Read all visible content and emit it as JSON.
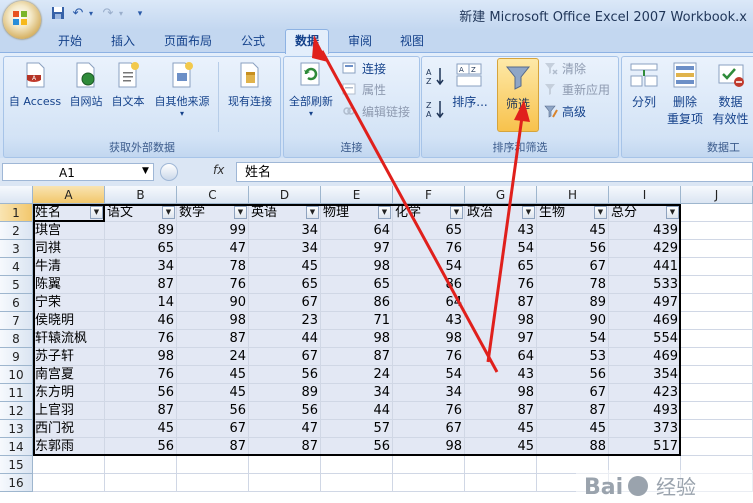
{
  "window": {
    "title": "新建 Microsoft Office Excel 2007 Workbook.x"
  },
  "quick_access": [
    "save-icon",
    "undo-icon",
    "redo-icon",
    "customize-icon"
  ],
  "tabs": [
    {
      "label": "开始"
    },
    {
      "label": "插入"
    },
    {
      "label": "页面布局"
    },
    {
      "label": "公式"
    },
    {
      "label": "数据",
      "active": true
    },
    {
      "label": "审阅"
    },
    {
      "label": "视图"
    }
  ],
  "ribbon": {
    "get_external": {
      "label": "获取外部数据",
      "buttons": [
        "自 Access",
        "自网站",
        "自文本",
        "自其他来源",
        "现有连接"
      ]
    },
    "connections": {
      "label": "连接",
      "refresh_all": "全部刷新",
      "connections": "连接",
      "properties": "属性",
      "edit_links": "编辑链接"
    },
    "sort_filter": {
      "label": "排序和筛选",
      "sort": "排序...",
      "filter": "筛选",
      "clear": "清除",
      "reapply": "重新应用",
      "advanced": "高级"
    },
    "data_tools": {
      "label": "数据工",
      "text_to_columns": "分列",
      "remove_duplicates_1": "删除",
      "remove_duplicates_2": "重复项",
      "validation_1": "数据",
      "validation_2": "有效性"
    }
  },
  "formula_bar": {
    "name_box": "A1",
    "fx": "fx",
    "value": "姓名"
  },
  "columns": [
    "A",
    "B",
    "C",
    "D",
    "E",
    "F",
    "G",
    "H",
    "I",
    "J"
  ],
  "rows": [
    "1",
    "2",
    "3",
    "4",
    "5",
    "6",
    "7",
    "8",
    "9",
    "10",
    "11",
    "12",
    "13",
    "14",
    "15",
    "16"
  ],
  "headers": [
    "姓名",
    "语文",
    "数学",
    "英语",
    "物理",
    "化学",
    "政治",
    "生物",
    "总分"
  ],
  "data": [
    [
      "琪宫",
      "89",
      "99",
      "34",
      "64",
      "65",
      "43",
      "45",
      "439"
    ],
    [
      "司祺",
      "65",
      "47",
      "34",
      "97",
      "76",
      "54",
      "56",
      "429"
    ],
    [
      "牛清",
      "34",
      "78",
      "45",
      "98",
      "54",
      "65",
      "67",
      "441"
    ],
    [
      "陈翼",
      "87",
      "76",
      "65",
      "65",
      "86",
      "76",
      "78",
      "533"
    ],
    [
      "宁荣",
      "14",
      "90",
      "67",
      "86",
      "64",
      "87",
      "89",
      "497"
    ],
    [
      "侯晓明",
      "46",
      "98",
      "23",
      "71",
      "43",
      "98",
      "90",
      "469"
    ],
    [
      "轩辕流枫",
      "76",
      "87",
      "44",
      "98",
      "98",
      "97",
      "54",
      "554"
    ],
    [
      "苏子轩",
      "98",
      "24",
      "67",
      "87",
      "76",
      "64",
      "53",
      "469"
    ],
    [
      "南宫夏",
      "76",
      "45",
      "56",
      "24",
      "54",
      "43",
      "56",
      "354"
    ],
    [
      "东方明",
      "56",
      "45",
      "89",
      "34",
      "34",
      "98",
      "67",
      "423"
    ],
    [
      "上官羽",
      "87",
      "56",
      "56",
      "44",
      "76",
      "87",
      "87",
      "493"
    ],
    [
      "西门祝",
      "45",
      "67",
      "47",
      "57",
      "67",
      "45",
      "45",
      "373"
    ],
    [
      "东郭雨",
      "56",
      "87",
      "87",
      "56",
      "98",
      "45",
      "88",
      "517"
    ]
  ],
  "watermark": "Bai 经验"
}
